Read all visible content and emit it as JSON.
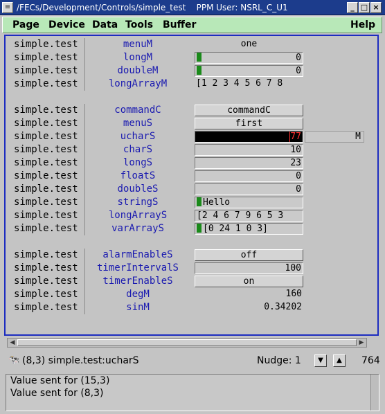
{
  "window": {
    "title": "/FECs/Development/Controls/simple_test    PPM User: NSRL_C_U1",
    "icon": "app-menu-icon"
  },
  "menu": [
    "Page",
    "Device",
    "Data",
    "Tools",
    "Buffer",
    "Help"
  ],
  "rows": [
    {
      "dev": "simple.test",
      "prop": "menuM",
      "type": "flat",
      "value": "one"
    },
    {
      "dev": "simple.test",
      "prop": "longM",
      "type": "barval",
      "value": "0"
    },
    {
      "dev": "simple.test",
      "prop": "doubleM",
      "type": "barval",
      "value": "0"
    },
    {
      "dev": "simple.test",
      "prop": "longArrayM",
      "type": "flatl",
      "value": "[1 2 3 4 5 6 7 8"
    },
    {
      "dev": "simple.test",
      "prop": "commandC",
      "type": "button",
      "value": "commandC"
    },
    {
      "dev": "simple.test",
      "prop": "menuS",
      "type": "button",
      "value": "first"
    },
    {
      "dev": "simple.test",
      "prop": "ucharS",
      "type": "selected",
      "value": "77",
      "extra": "M"
    },
    {
      "dev": "simple.test",
      "prop": "charS",
      "type": "field",
      "value": "10"
    },
    {
      "dev": "simple.test",
      "prop": "longS",
      "type": "field",
      "value": "23"
    },
    {
      "dev": "simple.test",
      "prop": "floatS",
      "type": "field",
      "value": "0"
    },
    {
      "dev": "simple.test",
      "prop": "doubleS",
      "type": "field",
      "value": "0"
    },
    {
      "dev": "simple.test",
      "prop": "stringS",
      "type": "barleft",
      "value": "Hello"
    },
    {
      "dev": "simple.test",
      "prop": "longArrayS",
      "type": "fieldl",
      "value": "[2 4 6 7 9 6 5 3"
    },
    {
      "dev": "simple.test",
      "prop": "varArrayS",
      "type": "barleft",
      "value": "[0 24 1 0 3]"
    },
    {
      "dev": "simple.test",
      "prop": "alarmEnableS",
      "type": "button",
      "value": "off"
    },
    {
      "dev": "simple.test",
      "prop": "timerIntervalS",
      "type": "field",
      "value": "100"
    },
    {
      "dev": "simple.test",
      "prop": "timerEnableS",
      "type": "button",
      "value": "on"
    },
    {
      "dev": "simple.test",
      "prop": "degM",
      "type": "flat",
      "value": "160",
      "align": "r"
    },
    {
      "dev": "simple.test",
      "prop": "sinM",
      "type": "flat",
      "value": "0.34202",
      "align": "r"
    }
  ],
  "status": {
    "location": "(8,3) simple.test:ucharS",
    "nudge_label": "Nudge: 1",
    "count": "764",
    "icon": "device-icon"
  },
  "messages": [
    "Value sent for (15,3)",
    "Value sent for (8,3)"
  ]
}
